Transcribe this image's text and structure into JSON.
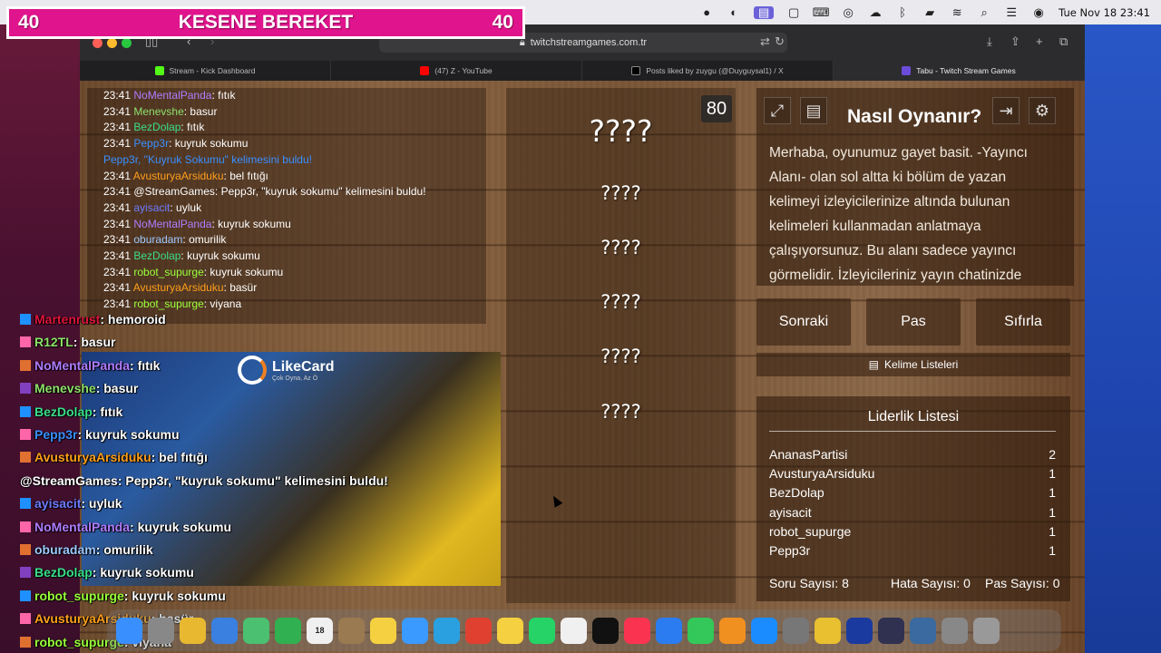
{
  "menubar": {
    "clock": "Tue Nov 18  23:41"
  },
  "browser": {
    "url": "twitchstreamgames.com.tr",
    "tabs": [
      {
        "label": "Stream - Kick Dashboard",
        "color": "#53fc18"
      },
      {
        "label": "(47) Z - YouTube",
        "color": "#ff0000"
      },
      {
        "label": "Posts liked by zuygu (@Duyguysal1) / X",
        "color": "#000000"
      },
      {
        "label": "Tabu - Twitch Stream Games",
        "color": "#6a4cd8"
      }
    ]
  },
  "chat": {
    "messages": [
      {
        "time": "23:41",
        "user": "NoMentalPanda",
        "color": "#b07cff",
        "text": ": fıtık"
      },
      {
        "time": "23:41",
        "user": "Menevshe",
        "color": "#8fe06a",
        "text": ": basur"
      },
      {
        "time": "23:41",
        "user": "BezDolap",
        "color": "#3adf8a",
        "text": ": fıtık"
      },
      {
        "time": "23:41",
        "user": "Pepp3r",
        "color": "#3a8fff",
        "text": ": kuyruk sokumu"
      },
      {
        "time": "",
        "user": "Pepp3r, \"Kuyruk Sokumu\" kelimesini buldu!",
        "color": "#3a8fff",
        "text": ""
      },
      {
        "time": "23:41",
        "user": "AvusturyaArsiduku",
        "color": "#ff9f1a",
        "text": ": bel fıtığı"
      },
      {
        "time": "23:41",
        "user": "@StreamGames",
        "color": "#ffffff",
        "text": ": Pepp3r, \"kuyruk sokumu\" kelimesini buldu!"
      },
      {
        "time": "23:41",
        "user": "ayisacit",
        "color": "#6e7bff",
        "text": ": uyluk"
      },
      {
        "time": "23:41",
        "user": "NoMentalPanda",
        "color": "#b07cff",
        "text": ": kuyruk sokumu"
      },
      {
        "time": "23:41",
        "user": "oburadam",
        "color": "#9ec8ff",
        "text": ": omurilik"
      },
      {
        "time": "23:41",
        "user": "BezDolap",
        "color": "#3adf8a",
        "text": ": kuyruk sokumu"
      },
      {
        "time": "23:41",
        "user": "robot_supurge",
        "color": "#9aff3a",
        "text": ": kuyruk sokumu"
      },
      {
        "time": "23:41",
        "user": "AvusturyaArsiduku",
        "color": "#ff9f1a",
        "text": ": basür"
      },
      {
        "time": "23:41",
        "user": "robot_supurge",
        "color": "#9aff3a",
        "text": ": viyana"
      }
    ]
  },
  "game": {
    "timer": "80",
    "words": [
      "????",
      "????",
      "????",
      "????",
      "????",
      "????"
    ],
    "how_title": "Nasıl Oynanır?",
    "how_text": "Merhaba, oyunumuz gayet basit. -Yayıncı Alanı- olan sol altta ki bölüm de yazan kelimeyi izleyicilerinize altında bulunan kelimeleri kullanmadan anlatmaya çalışıyorsunuz. Bu alanı sadece yayıncı görmelidir. İzleyicileriniz yayın chatinizde",
    "buttons": {
      "next": "Sonraki",
      "pass": "Pas",
      "reset": "Sıfırla"
    },
    "list_button": "Kelime Listeleri",
    "leaderboard": {
      "title": "Liderlik Listesi",
      "rows": [
        {
          "name": "AnanasPartisi",
          "score": "2"
        },
        {
          "name": "AvusturyaArsiduku",
          "score": "1"
        },
        {
          "name": "BezDolap",
          "score": "1"
        },
        {
          "name": "ayisacit",
          "score": "1"
        },
        {
          "name": "robot_supurge",
          "score": "1"
        },
        {
          "name": "Pepp3r",
          "score": "1"
        }
      ],
      "stats": {
        "questions": "Soru Sayısı: 8",
        "errors": "Hata Sayısı: 0",
        "passes": "Pas Sayısı: 0"
      }
    }
  },
  "overlay": {
    "bar": {
      "left": "40",
      "title": "KESENE BEREKET",
      "right": "40",
      "color": "#e0148c"
    },
    "sponsor": {
      "name": "LikeCard",
      "tagline": "Çok Oyna, Az Ö"
    },
    "messages": [
      {
        "user": "Martenrust",
        "color": "#e0143c",
        "text": ": hemoroid"
      },
      {
        "user": "R12TL",
        "color": "#8fe06a",
        "text": ": basur"
      },
      {
        "user": "NoMentalPanda",
        "color": "#b07cff",
        "text": ": fıtık"
      },
      {
        "user": "Menevshe",
        "color": "#8fe06a",
        "text": ": basur"
      },
      {
        "user": "BezDolap",
        "color": "#3adf8a",
        "text": ": fıtık"
      },
      {
        "user": "Pepp3r",
        "color": "#3a8fff",
        "text": ": kuyruk sokumu"
      },
      {
        "user": "AvusturyaArsiduku",
        "color": "#ff9f1a",
        "text": ": bel fıtığı"
      },
      {
        "user": "@StreamGames",
        "color": "#ffffff",
        "text": ": Pepp3r, \"kuyruk sokumu\" kelimesini buldu!"
      },
      {
        "user": "ayisacit",
        "color": "#6e7bff",
        "text": ": uyluk"
      },
      {
        "user": "NoMentalPanda",
        "color": "#b07cff",
        "text": ": kuyruk sokumu"
      },
      {
        "user": "oburadam",
        "color": "#9ec8ff",
        "text": ": omurilik"
      },
      {
        "user": "BezDolap",
        "color": "#3adf8a",
        "text": ": kuyruk sokumu"
      },
      {
        "user": "robot_supurge",
        "color": "#9aff3a",
        "text": ": kuyruk sokumu"
      },
      {
        "user": "AvusturyaArsiduku",
        "color": "#ff9f1a",
        "text": ": basür"
      },
      {
        "user": "robot_supurge",
        "color": "#9aff3a",
        "text": ": viyana"
      }
    ]
  },
  "dock": {
    "calendar_day": "18",
    "apps": [
      "finder",
      "launchpad",
      "photos",
      "mail",
      "maps",
      "facetime",
      "calendar",
      "files",
      "notes",
      "safari",
      "telegram",
      "chrome",
      "notes2",
      "whatsapp",
      "freeform",
      "tv",
      "music",
      "keynote",
      "numbers",
      "pages",
      "appstore",
      "settings",
      "bus",
      "wd",
      "obs",
      "quicktime",
      "downloads",
      "trash"
    ]
  }
}
